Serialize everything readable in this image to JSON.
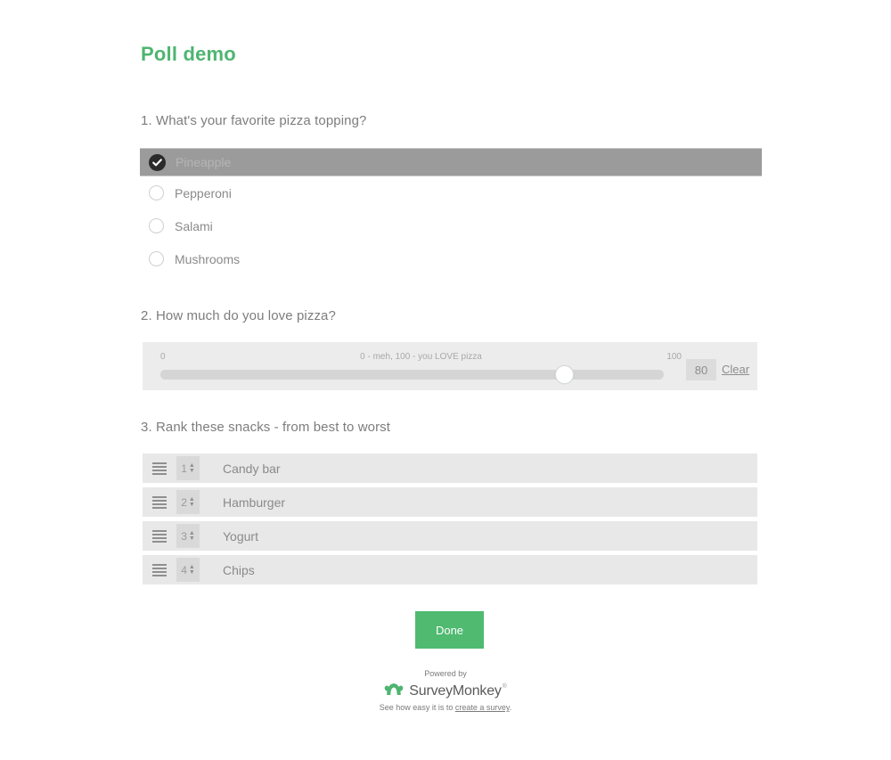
{
  "survey": {
    "title": "Poll demo"
  },
  "questions": [
    {
      "id": "q1",
      "text": "1. What's your favorite pizza topping?",
      "type": "single-choice",
      "choices": [
        {
          "label": "Pineapple",
          "selected": true
        },
        {
          "label": "Pepperoni",
          "selected": false
        },
        {
          "label": "Salami",
          "selected": false
        },
        {
          "label": "Mushrooms",
          "selected": false
        }
      ]
    },
    {
      "id": "q2",
      "text": "2. How much do you love pizza?",
      "type": "slider",
      "min_label": "0",
      "max_label": "100",
      "caption": "0 - meh, 100 - you LOVE pizza",
      "value": "80",
      "clear_label": "Clear"
    },
    {
      "id": "q3",
      "text": "3. Rank these snacks - from best to worst",
      "type": "ranking",
      "items": [
        {
          "rank": "1",
          "label": "Candy bar"
        },
        {
          "rank": "2",
          "label": "Hamburger"
        },
        {
          "rank": "3",
          "label": "Yogurt"
        },
        {
          "rank": "4",
          "label": "Chips"
        }
      ]
    }
  ],
  "actions": {
    "done_label": "Done"
  },
  "footer": {
    "powered_by": "Powered by",
    "brand": "SurveyMonkey",
    "trademark": "®",
    "tagline_prefix": "See how easy it is to ",
    "tagline_link": "create a survey",
    "tagline_suffix": "."
  },
  "colors": {
    "brand_green": "#4eb571",
    "button_green": "#4fba70",
    "selected_row": "#9b9b9b",
    "row_gray": "#e8e8e8",
    "panel_gray": "#ececec",
    "text_gray": "#8a8a8a"
  },
  "icons": {
    "check": "check-icon",
    "drag": "drag-handle-icon",
    "stepper_arrows": "↕"
  }
}
